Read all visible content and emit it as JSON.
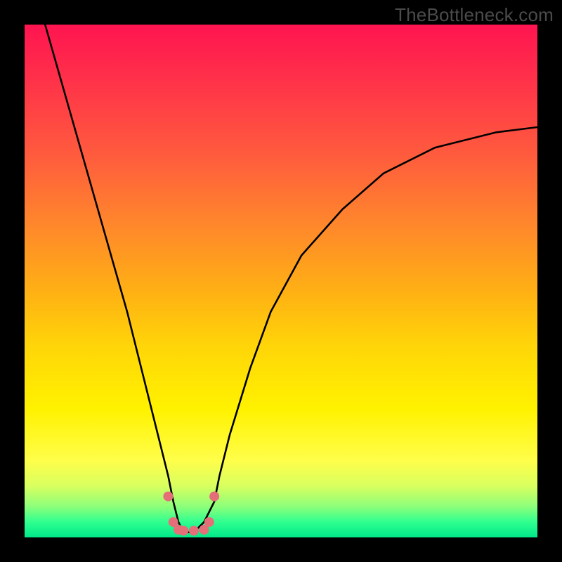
{
  "watermark": "TheBottleneck.com",
  "chart_data": {
    "type": "line",
    "title": "",
    "xlabel": "",
    "ylabel": "",
    "categories": [],
    "xlim": [
      0,
      100
    ],
    "ylim": [
      0,
      100
    ],
    "grid": false,
    "legend": false,
    "notch": {
      "x": 31,
      "floor_y": 1,
      "x_width": 12
    },
    "series": [
      {
        "name": "bottleneck-curve",
        "color": "#000000",
        "x": [
          4,
          8,
          12,
          16,
          20,
          24,
          26,
          28,
          29,
          30,
          31,
          33,
          35,
          37,
          38,
          40,
          44,
          48,
          54,
          62,
          70,
          80,
          92,
          100
        ],
        "y": [
          100,
          86,
          72,
          58,
          44,
          28,
          20,
          12,
          7,
          3,
          1,
          1,
          3,
          7,
          12,
          20,
          33,
          44,
          55,
          64,
          71,
          76,
          79,
          80
        ]
      },
      {
        "name": "notch-markers",
        "color": "#e46f78",
        "type": "scatter",
        "x": [
          28,
          29,
          30,
          31,
          33,
          35,
          36,
          37
        ],
        "y": [
          8,
          3,
          1.5,
          1.3,
          1.3,
          1.5,
          3,
          8
        ]
      }
    ]
  },
  "colors": {
    "background": "#000000",
    "gradient_top": "#ff1450",
    "gradient_mid": "#fff200",
    "gradient_bottom": "#00e88a",
    "curve": "#000000",
    "marker": "#e46f78"
  }
}
